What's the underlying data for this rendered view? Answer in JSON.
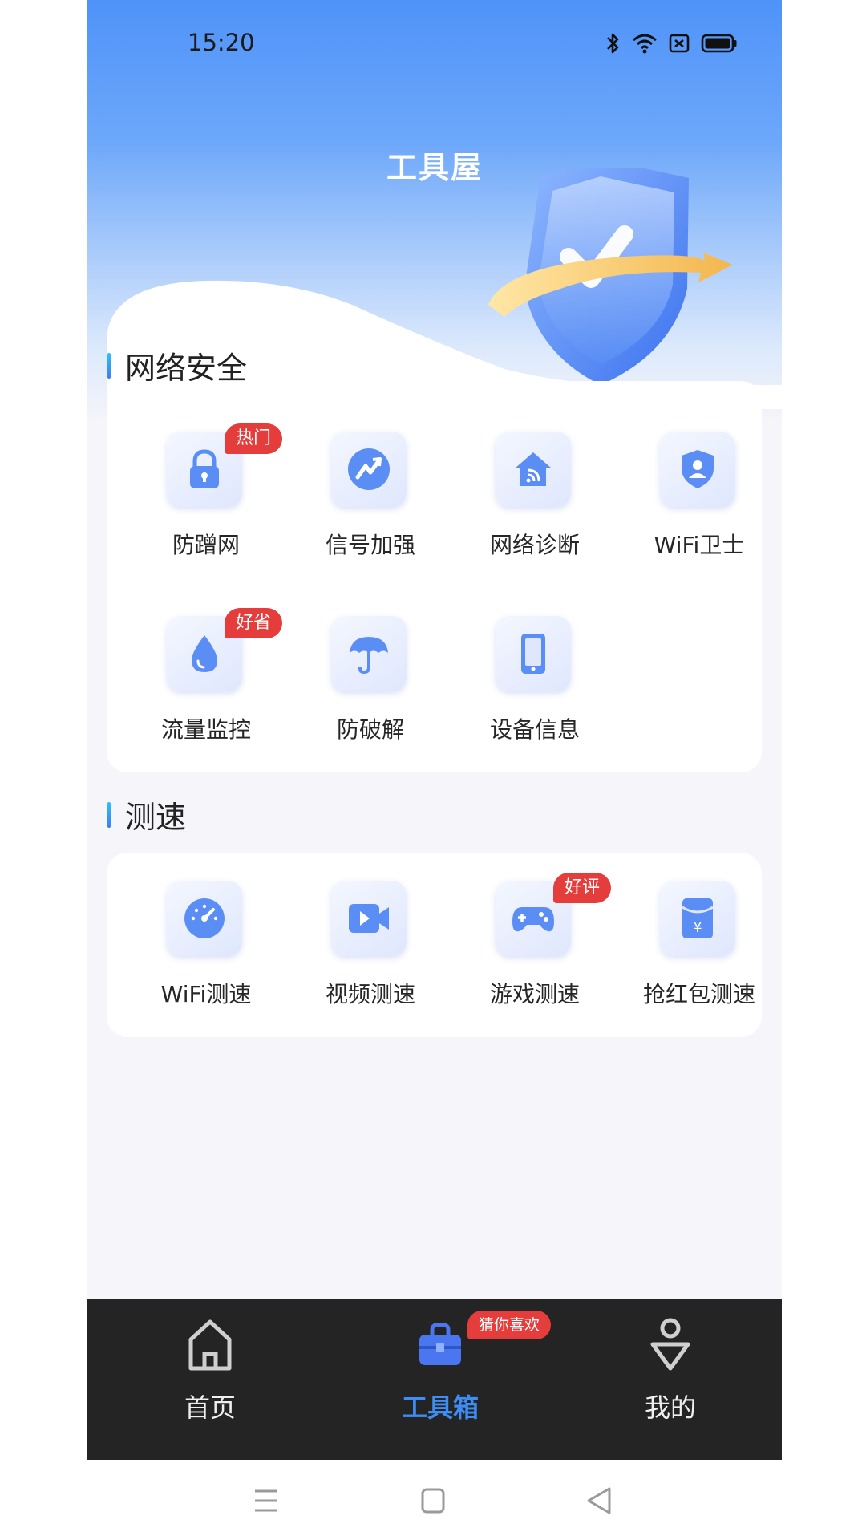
{
  "status_bar": {
    "time": "15:20",
    "icons": [
      "bluetooth-icon",
      "wifi-icon",
      "sim-off-icon",
      "battery-icon"
    ]
  },
  "header": {
    "title": "工具屋"
  },
  "network_security": {
    "title": "网络安全",
    "items": [
      {
        "label": "防蹭网",
        "icon": "lock-icon",
        "badge": "热门"
      },
      {
        "label": "信号加强",
        "icon": "signal-boost-icon"
      },
      {
        "label": "网络诊断",
        "icon": "home-network-icon"
      },
      {
        "label": "WiFi卫士",
        "icon": "wifi-guard-shield-icon"
      },
      {
        "label": "流量监控",
        "icon": "water-drop-icon",
        "badge": "好省"
      },
      {
        "label": "防破解",
        "icon": "umbrella-icon"
      },
      {
        "label": "设备信息",
        "icon": "phone-device-icon"
      }
    ]
  },
  "speed_test": {
    "title": "测速",
    "items": [
      {
        "label": "WiFi测速",
        "icon": "speedometer-icon"
      },
      {
        "label": "视频测速",
        "icon": "video-camera-icon"
      },
      {
        "label": "游戏测速",
        "icon": "gamepad-icon",
        "badge": "好评"
      },
      {
        "label": "抢红包测速",
        "icon": "red-packet-icon"
      }
    ]
  },
  "tab_bar": {
    "items": [
      {
        "label": "首页",
        "icon": "home-icon",
        "active": false
      },
      {
        "label": "工具箱",
        "icon": "toolbox-icon",
        "active": true,
        "badge": "猜你喜欢"
      },
      {
        "label": "我的",
        "icon": "profile-icon",
        "active": false
      }
    ]
  },
  "colors": {
    "accent": "#3d8df5",
    "badge": "#e53c3c",
    "tab_bar_bg": "#242424",
    "hero_blue": "#4f93f9",
    "icon_blue": "#5b8ef5"
  },
  "system_nav": {
    "buttons": [
      "menu-icon",
      "home-square-icon",
      "back-triangle-icon"
    ]
  }
}
